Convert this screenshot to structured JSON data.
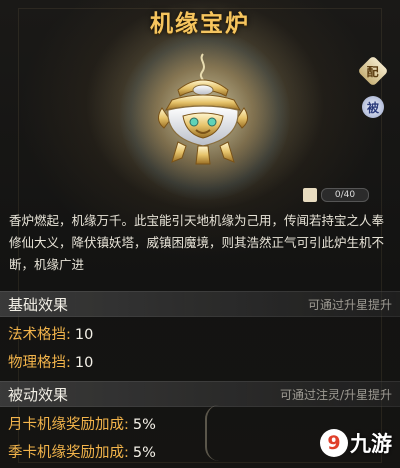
{
  "title": "机缘宝炉",
  "icons": {
    "item": "incense-burner-icon",
    "side_top": "scroll-badge-icon",
    "side_bottom": "passive-badge-icon",
    "fragment": "puzzle-piece-icon",
    "watermark": "9game-logo"
  },
  "side_buttons": {
    "top_label": "配",
    "bottom_label": "被"
  },
  "fragment": {
    "progress_text": "0/40",
    "progress_fraction": 0
  },
  "description": "香炉燃起，机缘万千。此宝能引天地机缘为己用，传闻若持宝之人奉修仙大义，降伏镇妖塔，威镇困魔境，则其浩然正气可引此炉生机不断，机缘广进",
  "basic_effect": {
    "heading": "基础效果",
    "hint": "可通过升星提升",
    "stats": [
      {
        "label": "法术格挡:",
        "value": "10"
      },
      {
        "label": "物理格挡:",
        "value": "10"
      }
    ]
  },
  "passive_effect": {
    "heading": "被动效果",
    "hint": "可通过注灵/升星提升",
    "stats": [
      {
        "label": "月卡机缘奖励加成:",
        "value": "5%"
      },
      {
        "label": "季卡机缘奖励加成:",
        "value": "5%"
      }
    ]
  },
  "watermark": {
    "mark": "9",
    "text": "九游"
  },
  "colors": {
    "title": "#f6c55e",
    "stat_label": "#f2b44b",
    "stat_value": "#f4f1e8"
  }
}
